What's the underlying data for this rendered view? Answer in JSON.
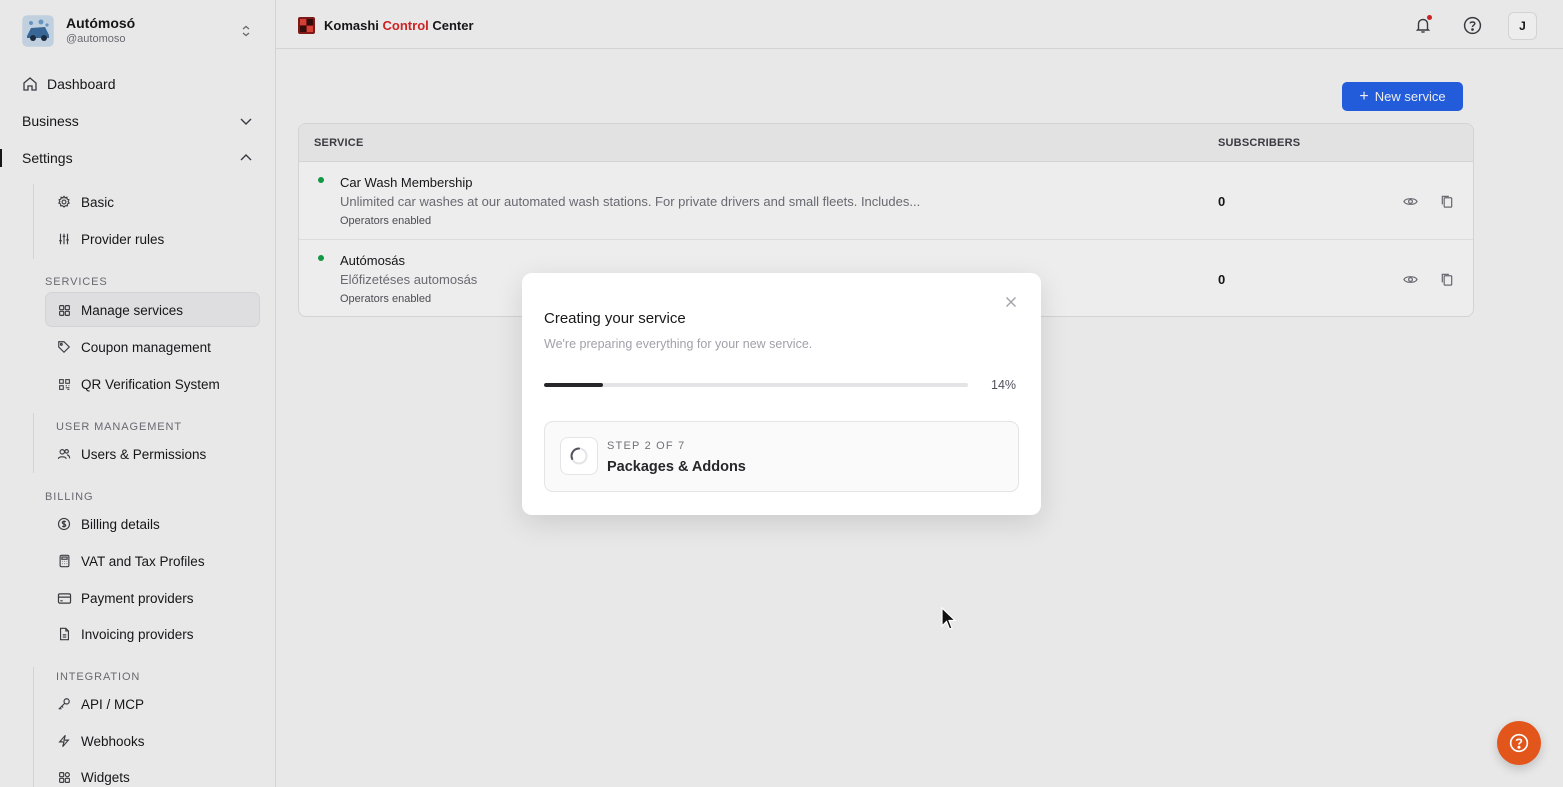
{
  "account": {
    "name": "Autómosó",
    "handle": "@automoso"
  },
  "sidebar": {
    "top": [
      {
        "label": "Dashboard",
        "icon": "home-icon"
      },
      {
        "label": "Business",
        "icon": "chevron-down-icon"
      },
      {
        "label": "Settings",
        "icon": "chevron-up-icon"
      }
    ],
    "settings_items": [
      {
        "label": "Basic",
        "icon": "gear-icon"
      },
      {
        "label": "Provider rules",
        "icon": "sliders-icon"
      }
    ],
    "sections": {
      "services": "SERVICES",
      "user_management": "USER MANAGEMENT",
      "billing": "BILLING",
      "integration": "INTEGRATION"
    },
    "services_items": [
      {
        "label": "Manage services",
        "icon": "grid-icon"
      },
      {
        "label": "Coupon management",
        "icon": "tag-icon"
      },
      {
        "label": "QR Verification System",
        "icon": "qr-code-icon"
      }
    ],
    "user_items": [
      {
        "label": "Users & Permissions",
        "icon": "users-icon"
      }
    ],
    "billing_items": [
      {
        "label": "Billing details",
        "icon": "dollar-circle-icon"
      },
      {
        "label": "VAT and Tax Profiles",
        "icon": "calculator-icon"
      },
      {
        "label": "Payment providers",
        "icon": "credit-card-icon"
      },
      {
        "label": "Invoicing providers",
        "icon": "file-icon"
      }
    ],
    "integration_items": [
      {
        "label": "API / MCP",
        "icon": "key-icon"
      },
      {
        "label": "Webhooks",
        "icon": "zap-icon"
      },
      {
        "label": "Widgets",
        "icon": "widgets-icon"
      }
    ]
  },
  "header": {
    "brand_part1": "Komashi",
    "brand_part2": "Control",
    "brand_part3": "Center",
    "user_initial": "J"
  },
  "main": {
    "new_service_label": "New service",
    "columns": {
      "service": "SERVICE",
      "subscribers": "SUBSCRIBERS"
    },
    "rows": [
      {
        "name": "Car Wash Membership",
        "description": "Unlimited car washes at our automated wash stations. For private drivers and small fleets. Includes...",
        "meta": "Operators enabled",
        "subscribers": "0"
      },
      {
        "name": "Autómosás",
        "description": "Előfizetéses automosás",
        "meta": "Operators enabled",
        "subscribers": "0"
      }
    ]
  },
  "modal": {
    "title": "Creating your service",
    "subtitle": "We're preparing everything for your new service.",
    "progress": 14,
    "progress_label": "14%",
    "step_count": "STEP 2 OF 7",
    "step_name": "Packages & Addons"
  },
  "colors": {
    "accent": "#2563eb",
    "active_dot": "#16a34a",
    "help_fab": "#e2561c",
    "brand_red": "#dc2626"
  }
}
